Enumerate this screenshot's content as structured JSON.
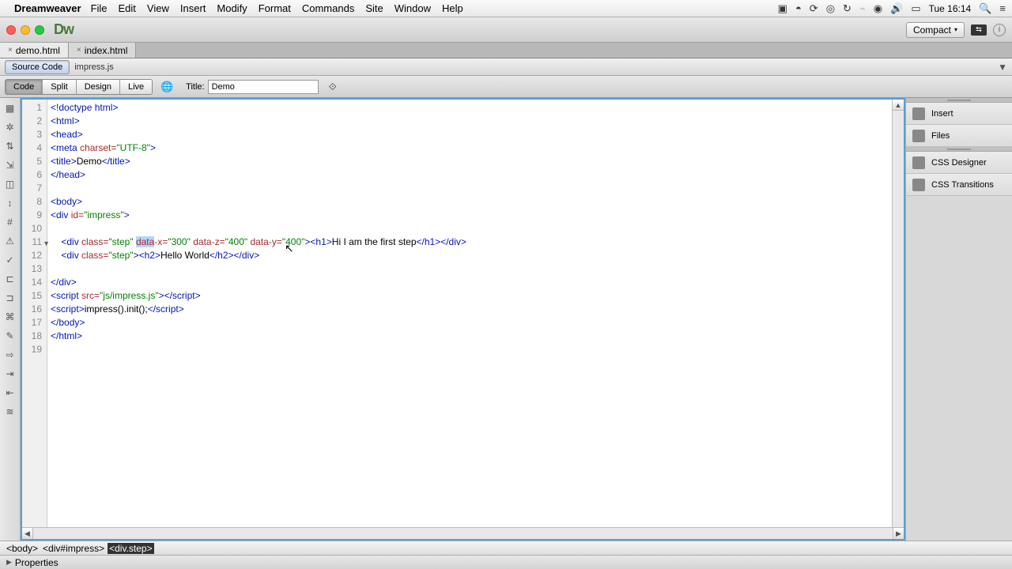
{
  "menubar": {
    "appname": "Dreamweaver",
    "items": [
      "File",
      "Edit",
      "View",
      "Insert",
      "Modify",
      "Format",
      "Commands",
      "Site",
      "Window",
      "Help"
    ],
    "clock": "Tue 16:14"
  },
  "titlebar": {
    "dw_logo": "Dw",
    "compact": "Compact"
  },
  "doc_tabs": [
    {
      "label": "demo.html",
      "active": true
    },
    {
      "label": "index.html",
      "active": false
    }
  ],
  "source_bar": {
    "source_code": "Source Code",
    "file": "impress.js"
  },
  "toolbar": {
    "views": [
      {
        "label": "Code",
        "active": true
      },
      {
        "label": "Split",
        "active": false
      },
      {
        "label": "Design",
        "active": false
      },
      {
        "label": "Live",
        "active": false
      }
    ],
    "title_label": "Title:",
    "title_value": "Demo"
  },
  "code_lines": [
    "<!doctype html>",
    "<html>",
    "<head>",
    "<meta charset=\"UTF-8\">",
    "<title>Demo</title>",
    "</head>",
    "",
    "<body>",
    "<div id=\"impress\">",
    "",
    "    <div class=\"step\" data-x=\"300\" data-z=\"400\" data-y=\"400\"><h1>Hi I am the first step</h1></div>",
    "    <div class=\"step\"><h2>Hello World</h2></div>",
    "",
    "</div>",
    "<script src=\"js/impress.js\"></script>",
    "<script>impress().init();</script>",
    "</body>",
    "</html>",
    ""
  ],
  "line_count": 19,
  "fold_line": 11,
  "breadcrumb": [
    "<body>",
    "<div#impress>",
    "<div.step>"
  ],
  "breadcrumb_active": 2,
  "right_panel": {
    "items": [
      "Insert",
      "Files",
      "CSS Designer",
      "CSS Transitions"
    ]
  },
  "properties": {
    "label": "Properties"
  }
}
